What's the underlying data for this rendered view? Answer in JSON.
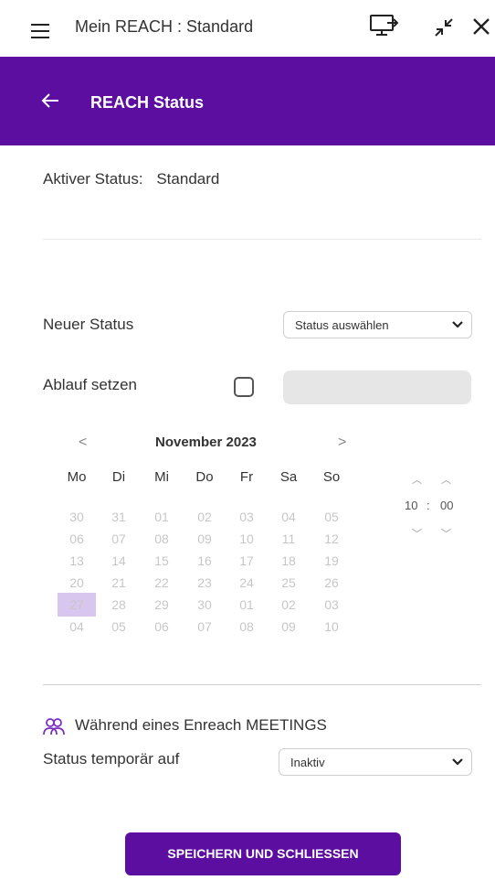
{
  "window": {
    "title": "Mein REACH : Standard",
    "icons": [
      "menu-icon",
      "screen-share-icon",
      "collapse-icon",
      "close-icon"
    ]
  },
  "header": {
    "title": "REACH Status",
    "back_icon": "arrow-left-icon",
    "color": "#5b0ea0"
  },
  "active_status": {
    "label": "Aktiver Status:",
    "value": "Standard"
  },
  "new_status": {
    "label": "Neuer Status",
    "select_value": "Status auswählen"
  },
  "expiry": {
    "label": "Ablauf setzen",
    "checked": false
  },
  "calendar": {
    "prev": "<",
    "next": ">",
    "month": "November 2023",
    "weekdays": [
      "Mo",
      "Di",
      "Mi",
      "Do",
      "Fr",
      "Sa",
      "So"
    ],
    "weeks": [
      [
        "30",
        "31",
        "01",
        "02",
        "03",
        "04",
        "05"
      ],
      [
        "06",
        "07",
        "08",
        "09",
        "10",
        "11",
        "12"
      ],
      [
        "13",
        "14",
        "15",
        "16",
        "17",
        "18",
        "19"
      ],
      [
        "20",
        "21",
        "22",
        "23",
        "24",
        "25",
        "26"
      ],
      [
        "27",
        "28",
        "29",
        "30",
        "01",
        "02",
        "03"
      ],
      [
        "04",
        "05",
        "06",
        "07",
        "08",
        "09",
        "10"
      ]
    ],
    "selected_day": "27",
    "selected_color": "#d9c6ee"
  },
  "time": {
    "hours": "10",
    "separator": ":",
    "minutes": "00"
  },
  "meeting": {
    "icon": "people-icon",
    "text": "Während eines Enreach MEETINGS",
    "temp_label": "Status temporär auf",
    "temp_value": "Inaktiv"
  },
  "save_button": "SPEICHERN UND SCHLIESSEN"
}
